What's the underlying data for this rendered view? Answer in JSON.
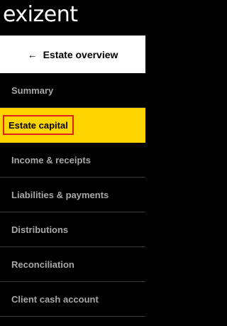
{
  "brand": {
    "logo_text": "exizent"
  },
  "back_link": {
    "icon": "arrow-left-icon",
    "label": "Estate overview"
  },
  "nav": {
    "items": [
      {
        "label": "Summary"
      },
      {
        "label": "Estate capital",
        "active": true
      },
      {
        "label": "Income & receipts"
      },
      {
        "label": "Liabilities & payments"
      },
      {
        "label": "Distributions"
      },
      {
        "label": "Reconciliation"
      },
      {
        "label": "Client cash account"
      }
    ]
  },
  "colors": {
    "background": "#000000",
    "active_bg": "#ffd500",
    "highlight_outline": "#e0201a",
    "inactive_text": "#a8a8a8"
  }
}
